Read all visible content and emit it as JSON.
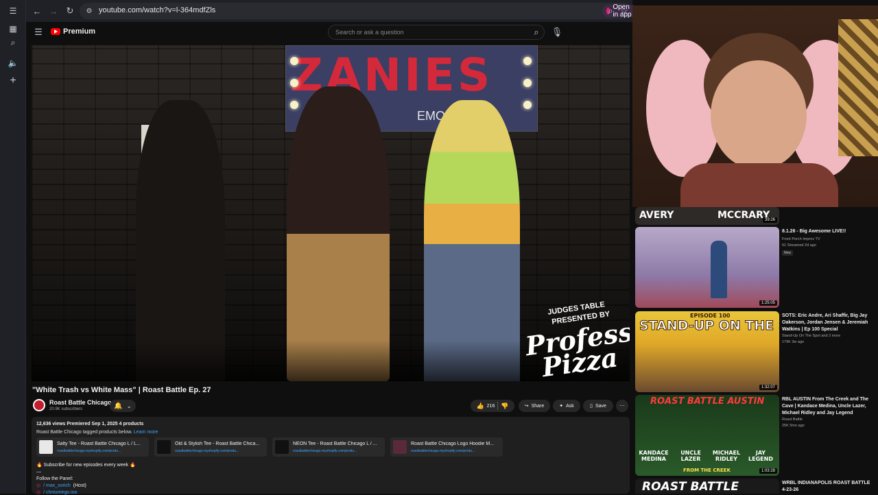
{
  "browser": {
    "url": "youtube.com/watch?v=l-364mdfZls",
    "open_in_app": "Open in app"
  },
  "masthead": {
    "logo_text": "Premium",
    "search_placeholder": "Search or ask a question"
  },
  "video": {
    "banner_text": "ZANIES",
    "banner_sub": "EMONT",
    "sponsor_line1": "JUDGES TABLE",
    "sponsor_line2": "PRESENTED BY",
    "sponsor_brand": "Professor Pizza",
    "title": "\"White Trash vs White Mass\" | Roast Battle Ep. 27"
  },
  "channel": {
    "name": "Roast Battle Chicago",
    "subscribers": "20.9K subscribers"
  },
  "actions": {
    "likes": "216",
    "share": "Share",
    "ask": "Ask",
    "save": "Save"
  },
  "description": {
    "meta": "12,636 views  Premiered Sep 1, 2025  4 products",
    "tagged": "Roast Battle Chicago tagged products below.",
    "learn_more": "Learn more",
    "products": [
      {
        "name": "Salty Tee - Roast Battle Chicago L / L...",
        "url": "roastbattlechicago.myshopify.com/produ..."
      },
      {
        "name": "Old & Stylish Tee - Roast Battle Chica...",
        "url": "roastbattlechicago.myshopify.com/produ..."
      },
      {
        "name": "NEON Tee - Roast Battle Chicago L / ...",
        "url": "roastbattlechicago.myshopify.com/produ..."
      },
      {
        "name": "Roast Battle Chicago Logo Hoodie M...",
        "url": "roastbattlechicago.myshopify.com/produ..."
      }
    ],
    "subscribe_line": "🔥 Subscribe for new episodes every week 🔥",
    "dash": "—",
    "follow": "Follow the Panel:",
    "panel": [
      {
        "handle": "/ max_sorich",
        "role": "(Host)"
      },
      {
        "handle": "/ chrisoriego.ioo",
        "role": ""
      }
    ]
  },
  "recommendations": [
    {
      "thumb_text_left": "AVERY",
      "thumb_text_right": "MCCRARY",
      "duration": "39:26",
      "title": "",
      "channel": "",
      "meta": ""
    },
    {
      "title": "8.1.26 - Big Awesome LIVE!!",
      "channel": "Front Porch Improv TV",
      "meta": "61  Streamed 2d ago",
      "badge": "New",
      "duration": "1:25:05"
    },
    {
      "title": "SOTS: Eric Andre, Ari Shaffir, Big Jay Oakerson, Jordan Jensen & Jeremiah Watkins | Ep 100 Special",
      "channel": "Stand-Up On The Spot and 2 more",
      "meta": "179K  3w ago",
      "duration": "1:32:07",
      "thumb_top": "EPISODE 100",
      "thumb_main": "STAND-UP ON THE SPOT"
    },
    {
      "title": "RBL AUSTIN From The Creek and The Cave | Kandace Medina, Uncle Lazer, Michael Ridley and Jay Legend",
      "channel": "Roast Battle",
      "meta": "25K  5mo ago",
      "duration": "1:03:28",
      "thumb_top": "ROAST BATTLE AUSTIN",
      "names": [
        "KANDACE MEDINA",
        "UNCLE LAZER",
        "MICHAEL RIDLEY",
        "JAY LEGEND"
      ],
      "thumb_bottom": "FROM THE CREEK"
    },
    {
      "title": "WRBL INDIANAPOLIS ROAST BATTLE 4-23-26",
      "channel": "",
      "meta": "",
      "thumb_main": "ROAST BATTLE"
    }
  ],
  "colors": {
    "accent_red": "#ff0000",
    "link_blue": "#3ea6ff",
    "background": "#0f0f0f"
  }
}
